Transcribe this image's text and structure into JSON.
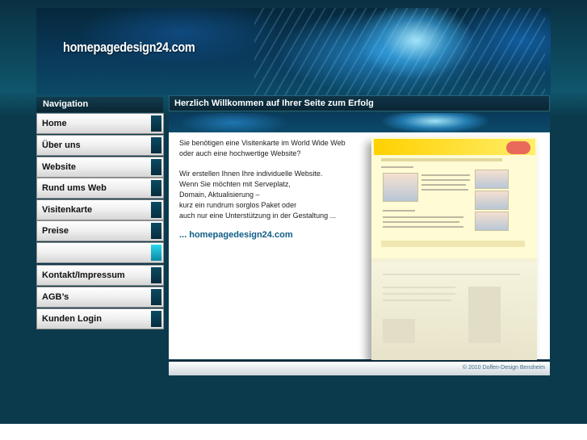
{
  "site": {
    "title": "homepagedesign24.com"
  },
  "navigation": {
    "heading": "Navigation",
    "items": [
      {
        "label": "Home"
      },
      {
        "label": "Über uns"
      },
      {
        "label": "Website"
      },
      {
        "label": "Rund ums Web"
      },
      {
        "label": "Visitenkarte"
      },
      {
        "label": "Preise"
      },
      {
        "label": ""
      },
      {
        "label": "Kontakt/Impressum"
      },
      {
        "label": "AGB’s"
      },
      {
        "label": "Kunden Login"
      }
    ]
  },
  "content": {
    "heading": "Herzlich Willkommen auf Ihrer Seite zum Erfolg",
    "lines": [
      "Sie benötigen eine Visitenkarte im World Wide Web",
      "oder auch eine hochwertige Website?",
      "Wir erstellen Ihnen Ihre individuelle Website.",
      "Wenn Sie möchten mit Serveplatz,",
      "Domain, Aktualisierung –",
      "kurz ein rundrum sorglos Paket oder",
      "auch nur eine Unterstützung in der Gestaltung ..."
    ],
    "link": "... homepagedesign24.com"
  },
  "footer": {
    "copyright": "© 2010 Dolfen-Design Bensheim"
  },
  "colors": {
    "background": "#0b3a4c",
    "link": "#0f5c86",
    "nav_marker": "#0c4a63",
    "nav_marker_active": "#2ad7ee"
  }
}
